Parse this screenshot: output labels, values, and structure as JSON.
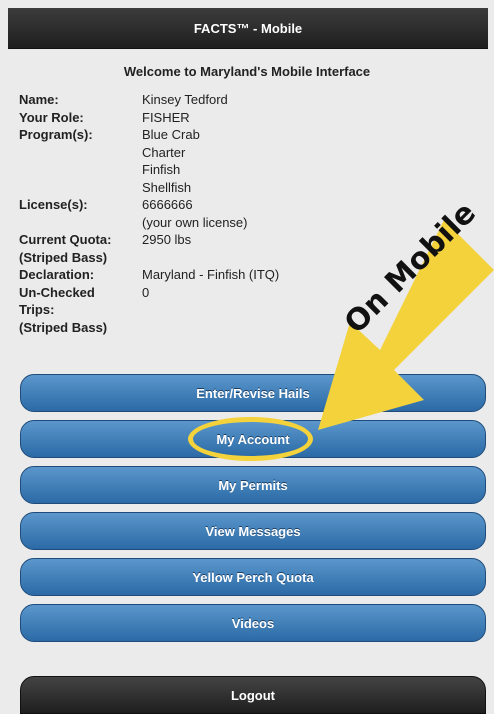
{
  "header": {
    "title": "FACTS™ - Mobile"
  },
  "welcome": "Welcome to Maryland's Mobile Interface",
  "profile": {
    "name_label": "Name:",
    "name": "Kinsey Tedford",
    "role_label": "Your Role:",
    "role": "FISHER",
    "programs_label": "Program(s):",
    "programs": [
      "Blue Crab",
      "Charter",
      "Finfish",
      "Shellfish"
    ],
    "license_label": "License(s):",
    "license": "6666666",
    "license_note": "(your own license)",
    "quota_label": [
      "Current Quota:",
      "(Striped Bass)"
    ],
    "quota": "2950 lbs",
    "declaration_label": "Declaration:",
    "declaration": "Maryland - Finfish (ITQ)",
    "unchecked_label": [
      "Un-Checked",
      "Trips:",
      "(Striped Bass)"
    ],
    "unchecked": "0"
  },
  "menu": {
    "hails": "Enter/Revise Hails",
    "account": "My Account",
    "permits": "My Permits",
    "messages": "View Messages",
    "perch": "Yellow Perch Quota",
    "videos": "Videos",
    "logout": "Logout"
  },
  "annotation": {
    "text": "On Mobile",
    "color": "#f4d23b"
  }
}
